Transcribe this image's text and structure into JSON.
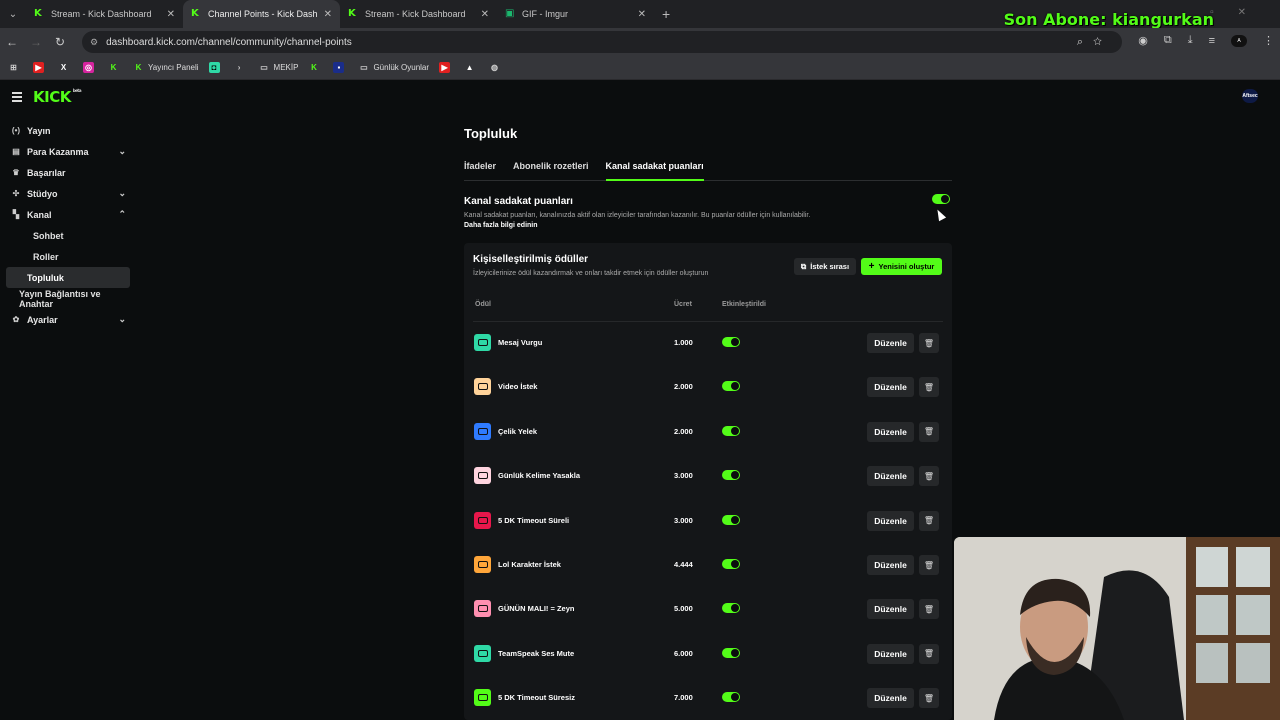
{
  "browser": {
    "tabs": [
      {
        "title": "Stream - Kick Dashboard",
        "icon": "kick-icon",
        "active": false
      },
      {
        "title": "Channel Points - Kick Dashboard",
        "icon": "kick-icon",
        "active": true
      },
      {
        "title": "Stream - Kick Dashboard",
        "icon": "kick-icon",
        "active": false
      },
      {
        "title": "GIF - Imgur",
        "icon": "imgur-icon",
        "active": false
      }
    ],
    "url": "dashboard.kick.com/channel/community/channel-points",
    "bookmarks": [
      "Yayıncı Paneli",
      "MEKİP",
      "Günlük Oyunlar"
    ]
  },
  "overlay": {
    "text": "Son Abone: kiangurkan"
  },
  "app": {
    "logo": "KICK",
    "logo_tag": "beta",
    "avatar": "Aftsec"
  },
  "sidebar": {
    "items": [
      {
        "label": "Yayın",
        "icon": "broadcast-icon"
      },
      {
        "label": "Para Kazanma",
        "icon": "wallet-icon"
      },
      {
        "label": "Başarılar",
        "icon": "trophy-icon"
      },
      {
        "label": "Stüdyo",
        "icon": "studio-icon"
      },
      {
        "label": "Kanal",
        "icon": "channel-icon"
      }
    ],
    "sub": [
      "Sohbet",
      "Roller",
      "Topluluk"
    ],
    "plain": "Yayın Bağlantısı ve Anahtar",
    "settings": "Ayarlar"
  },
  "main": {
    "title": "Topluluk",
    "tabs": [
      "İfadeler",
      "Abonelik rozetleri",
      "Kanal sadakat puanları"
    ],
    "section_title": "Kanal sadakat puanları",
    "section_desc": "Kanal sadakat puanları, kanalınızda aktif olan izleyiciler tarafından kazanılır. Bu puanlar ödüller için kullanılabilir.",
    "section_link": "Daha fazla bilgi edinin",
    "enabled": true
  },
  "rewards": {
    "title": "Kişiselleştirilmiş ödüller",
    "desc": "İzleyicilerinize ödül kazandırmak ve onları takdir etmek için ödüller oluşturun",
    "queue_button": "İstek sırası",
    "new_button": "Yenisini oluştur",
    "col_reward": "Ödül",
    "col_cost": "Ücret",
    "col_enabled": "Etkinleştirildi",
    "edit_label": "Düzenle",
    "rows": [
      {
        "name": "Mesaj Vurgu",
        "cost": "1.000",
        "color": "#2fd9a6",
        "enabled": true
      },
      {
        "name": "Video İstek",
        "cost": "2.000",
        "color": "#ffd39a",
        "enabled": true
      },
      {
        "name": "Çelik Yelek",
        "cost": "2.000",
        "color": "#2f7bff",
        "enabled": true
      },
      {
        "name": "Günlük Kelime Yasakla",
        "cost": "3.000",
        "color": "#ffd4df",
        "enabled": true
      },
      {
        "name": "5 DK Timeout Süreli",
        "cost": "3.000",
        "color": "#e8174b",
        "enabled": true
      },
      {
        "name": "Lol Karakter İstek",
        "cost": "4.444",
        "color": "#ffa63a",
        "enabled": true
      },
      {
        "name": "GÜNÜN MALI! = Zeyn",
        "cost": "5.000",
        "color": "#ff8fb0",
        "enabled": true
      },
      {
        "name": "TeamSpeak Ses Mute",
        "cost": "6.000",
        "color": "#2fd9a6",
        "enabled": true
      },
      {
        "name": "5 DK Timeout Süresiz",
        "cost": "7.000",
        "color": "#53fc18",
        "enabled": true
      }
    ]
  }
}
